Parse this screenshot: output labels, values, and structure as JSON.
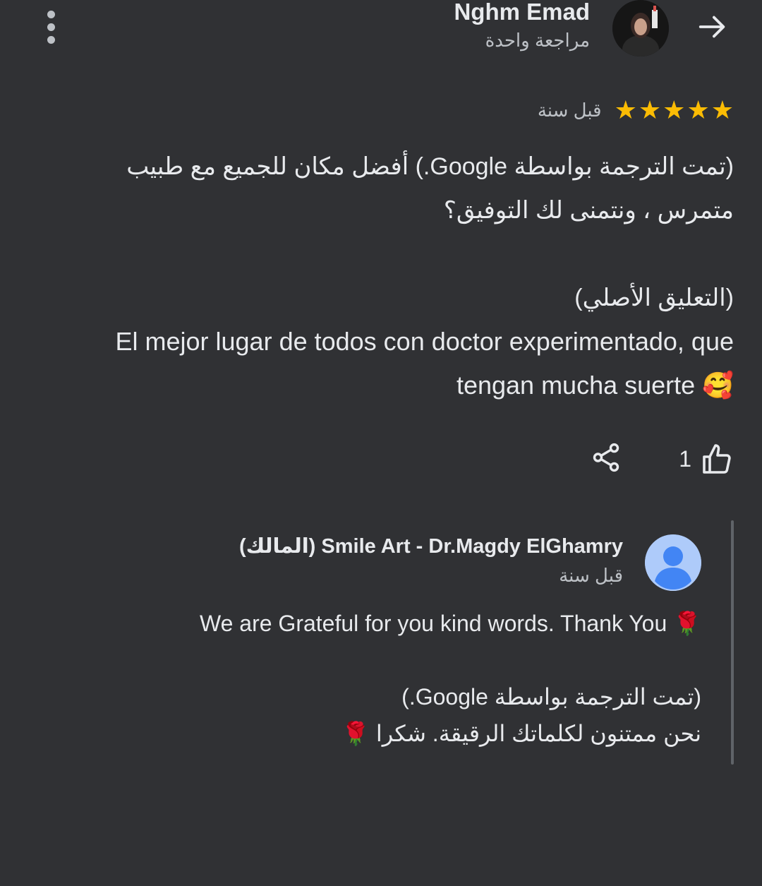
{
  "header": {
    "reviewer_name": "Nghm Emad",
    "reviewer_subtitle": "مراجعة واحدة"
  },
  "review": {
    "rating": 5,
    "stars": [
      "★",
      "★",
      "★",
      "★",
      "★"
    ],
    "date": "قبل سنة",
    "translated_line1": "(تمت الترجمة بواسطة Google.) أفضل مكان للجميع مع طبيب",
    "translated_line2": "متمرس ، ونتمنى لك التوفيق؟",
    "original_heading": "(التعليق الأصلي)",
    "original_line1": "El mejor lugar de todos con doctor experimentado, que",
    "original_line2": "tengan mucha suerte 🥰"
  },
  "actions": {
    "like_count": "1"
  },
  "owner_reply": {
    "name": "Smile Art - Dr.Magdy ElGhamry (المالك)",
    "date": "قبل سنة",
    "text_line1": "We are Grateful for you kind words. Thank You 🌹",
    "translated_heading": "(تمت الترجمة بواسطة Google.)",
    "translated_text": "نحن ممتنون لكلماتك الرقيقة. شكرا 🌹"
  },
  "colors": {
    "background": "#303134",
    "star": "#fbbc04",
    "text_primary": "#e8eaed",
    "text_secondary": "#bdc1c6",
    "reply_avatar": "#aecbfa",
    "reply_avatar_figure": "#4285f4"
  }
}
